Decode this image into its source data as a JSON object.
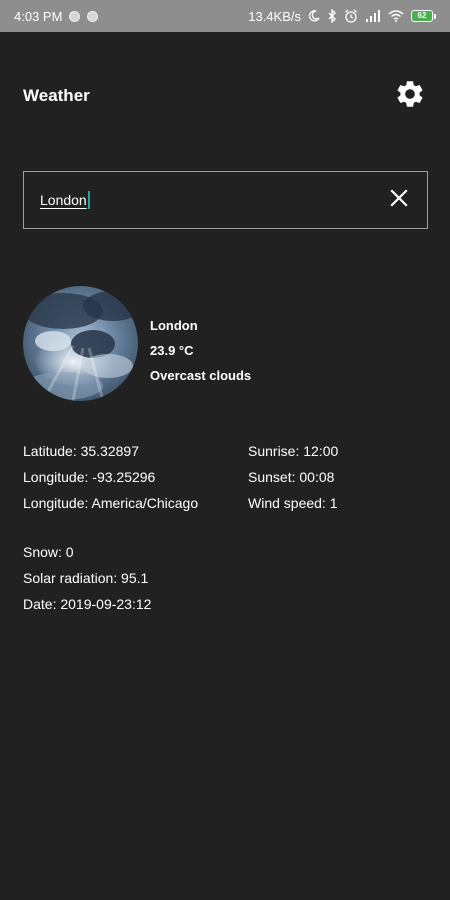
{
  "status_bar": {
    "time": "4:03 PM",
    "network_speed": "13.4KB/s",
    "battery_level": "62",
    "icons": [
      "moon-icon",
      "bluetooth-icon",
      "alarm-icon",
      "signal-icon",
      "wifi-icon",
      "battery-icon"
    ]
  },
  "header": {
    "title": "Weather",
    "settings_icon": "gear-icon"
  },
  "search": {
    "value": "London",
    "clear_icon": "close-icon"
  },
  "summary": {
    "city": "London",
    "temperature": "23.9 °C",
    "description": "Overcast clouds",
    "image": "overcast-clouds-photo"
  },
  "details": {
    "latitude": "Latitude: 35.32897",
    "longitude": "Longitude: -93.25296",
    "timezone": "Longitude: America/Chicago",
    "sunrise": "Sunrise: 12:00",
    "sunset": "Sunset: 00:08",
    "wind_speed": "Wind speed: 1",
    "snow": "Snow: 0",
    "solar_radiation": "Solar radiation: 95.1",
    "date": "Date: 2019-09-23:12"
  },
  "colors": {
    "background": "#212121",
    "status_bar": "#8e8e8e",
    "accent_cursor": "#26a69a",
    "battery": "#4caf50"
  }
}
